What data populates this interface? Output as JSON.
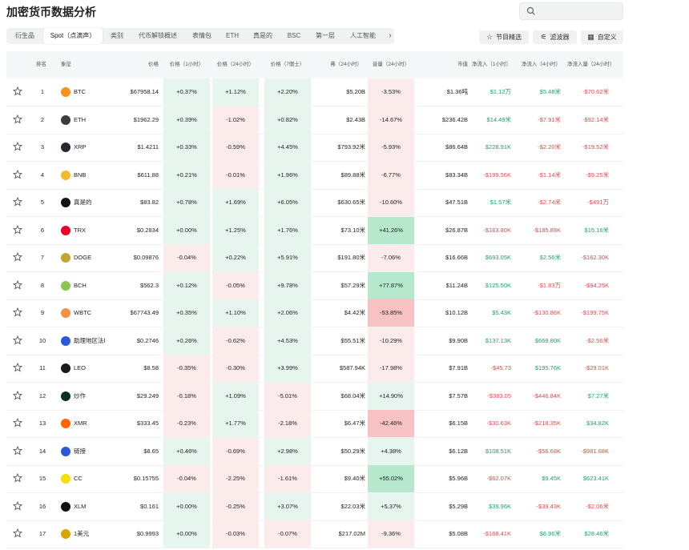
{
  "page": {
    "title": "加密货币数据分析"
  },
  "search": {
    "placeholder": ""
  },
  "tabs": [
    {
      "label": "衍生品"
    },
    {
      "label": "Spot（点滴声）"
    },
    {
      "label": "类别"
    },
    {
      "label": "代币解锁概述"
    },
    {
      "label": "表情包"
    },
    {
      "label": "ETH"
    },
    {
      "label": "真是的"
    },
    {
      "label": "BSC"
    },
    {
      "label": "第一层"
    },
    {
      "label": "人工智能"
    }
  ],
  "tab_more_icon": "chevron-right-icon",
  "toolbar": {
    "featured_label": "节目精选",
    "filter_label": "滤波器",
    "custom_label": "自定义"
  },
  "headers": {
    "rank": "排名",
    "symbol": "象征",
    "price": "价格",
    "chg_1h": "价格（1小时）",
    "chg_24h": "价格（24小时）",
    "chg_7d": "价格（7個士）",
    "vol_24h": "弗（24小时）",
    "vol_chg_24h": "音量（24小时）",
    "mcap": "市值",
    "inflow_1h": "净流入（1小时）",
    "inflow_4h": "净流入（4小时）",
    "inflow_24h": "净流入量（24小时）"
  },
  "colors": {
    "positive": "#1aa568",
    "negative": "#e04a4a",
    "positive_bg": "#e6f6ee",
    "negative_bg": "#fcebeb",
    "strong_positive_bg": "#b6e8cd",
    "strong_negative_bg": "#f8c2c2"
  },
  "rows": [
    {
      "rank": "1",
      "name": "BTC",
      "icon": "btc-icon",
      "icon_color": "#f7931a",
      "price": "$67958.14",
      "c1h": "+0.37%",
      "c24h": "+1.12%",
      "c7d": "+2.20%",
      "vol": "$5.20B",
      "volc": "-3.53%",
      "mcap": "$1.36吨",
      "in1h": "$1.12万",
      "in4h": "$5.48米",
      "in24h": "-$70.62米"
    },
    {
      "rank": "2",
      "name": "ETH",
      "icon": "eth-icon",
      "icon_color": "#3c3c3d",
      "price": "$1962.29",
      "c1h": "+0.39%",
      "c24h": "-1.02%",
      "c7d": "+0.82%",
      "vol": "$2.43B",
      "volc": "-14.67%",
      "mcap": "$236.42B",
      "in1h": "$14.49米",
      "in4h": "-$7.91米",
      "in24h": "-$92.14米"
    },
    {
      "rank": "3",
      "name": "XRP",
      "icon": "xrp-icon",
      "icon_color": "#23292f",
      "price": "$1.4211",
      "c1h": "+0.33%",
      "c24h": "-0.59%",
      "c7d": "+4.45%",
      "vol": "$793.92米",
      "volc": "-5.93%",
      "mcap": "$86.64B",
      "in1h": "$228.91K",
      "in4h": "-$2.20米",
      "in24h": "-$19.52米"
    },
    {
      "rank": "4",
      "name": "BNB",
      "icon": "bnb-icon",
      "icon_color": "#f3ba2f",
      "price": "$611.88",
      "c1h": "+0.21%",
      "c24h": "-0.01%",
      "c7d": "+1.96%",
      "vol": "$89.88米",
      "volc": "-6.77%",
      "mcap": "$83.34B",
      "in1h": "-$199.56K",
      "in4h": "-$1.14米",
      "in24h": "-$9.25米"
    },
    {
      "rank": "5",
      "name": "真是的",
      "icon": "sol-icon",
      "icon_color": "#111111",
      "price": "$83.82",
      "c1h": "+0.78%",
      "c24h": "+1.69%",
      "c7d": "+6.05%",
      "vol": "$630.65米",
      "volc": "-10.60%",
      "mcap": "$47.51B",
      "in1h": "$1.57米",
      "in4h": "-$2.74米",
      "in24h": "-$491万"
    },
    {
      "rank": "6",
      "name": "TRX",
      "icon": "trx-icon",
      "icon_color": "#eb0029",
      "price": "$0.2834",
      "c1h": "+0.00%",
      "c24h": "+1.25%",
      "c7d": "+1.76%",
      "vol": "$73.10米",
      "volc": "+41.26%",
      "mcap": "$26.87B",
      "in1h": "-$163.80K",
      "in4h": "-$185.89K",
      "in24h": "$15.16米"
    },
    {
      "rank": "7",
      "name": "DOGE",
      "icon": "doge-icon",
      "icon_color": "#c2a633",
      "price": "$0.09876",
      "c1h": "-0.04%",
      "c24h": "+0.22%",
      "c7d": "+5.91%",
      "vol": "$191.80米",
      "volc": "-7.06%",
      "mcap": "$16.66B",
      "in1h": "$693.05K",
      "in4h": "$2.56米",
      "in24h": "-$162.30K"
    },
    {
      "rank": "8",
      "name": "BCH",
      "icon": "bch-icon",
      "icon_color": "#8dc351",
      "price": "$562.3",
      "c1h": "+0.12%",
      "c24h": "-0.05%",
      "c7d": "+9.78%",
      "vol": "$57.29米",
      "volc": "+77.87%",
      "mcap": "$11.24B",
      "in1h": "$125.50K",
      "in4h": "-$1.83万",
      "in24h": "-$94.25K"
    },
    {
      "rank": "9",
      "name": "WBTC",
      "icon": "wbtc-icon",
      "icon_color": "#f09242",
      "price": "$67743.49",
      "c1h": "+0.35%",
      "c24h": "+1.10%",
      "c7d": "+2.06%",
      "vol": "$4.42米",
      "volc": "-53.85%",
      "mcap": "$10.12B",
      "in1h": "$5.43K",
      "in4h": "-$130.86K",
      "in24h": "-$199.75K"
    },
    {
      "rank": "10",
      "name": "助理地区法l",
      "icon": "link-icon",
      "icon_color": "#2a5ada",
      "price": "$0.2746",
      "c1h": "+0.26%",
      "c24h": "-0.62%",
      "c7d": "+4.53%",
      "vol": "$55.51米",
      "volc": "-10.29%",
      "mcap": "$9.90B",
      "in1h": "$137.13K",
      "in4h": "$669.80K",
      "in24h": "-$2.56米"
    },
    {
      "rank": "11",
      "name": "LEO",
      "icon": "leo-icon",
      "icon_color": "#1a1a1a",
      "price": "$8.58",
      "c1h": "-0.35%",
      "c24h": "-0.30%",
      "c7d": "+3.99%",
      "vol": "$587.94K",
      "volc": "-17.98%",
      "mcap": "$7.91B",
      "in1h": "-$45.73",
      "in4h": "$195.76K",
      "in24h": "-$29.01K"
    },
    {
      "rank": "12",
      "name": "炒作",
      "icon": "hype-icon",
      "icon_color": "#0b2e26",
      "price": "$29.249",
      "c1h": "-0.18%",
      "c24h": "+1.09%",
      "c7d": "-5.01%",
      "vol": "$68.04米",
      "volc": "+14.90%",
      "mcap": "$7.57B",
      "in1h": "-$383.05",
      "in4h": "-$446.84K",
      "in24h": "$7.27米"
    },
    {
      "rank": "13",
      "name": "XMR",
      "icon": "xmr-icon",
      "icon_color": "#ff6600",
      "price": "$333.45",
      "c1h": "-0.23%",
      "c24h": "+1.77%",
      "c7d": "-2.18%",
      "vol": "$6.47米",
      "volc": "-42.46%",
      "mcap": "$6.15B",
      "in1h": "-$30.63K",
      "in4h": "-$218.35K",
      "in24h": "$34.82K"
    },
    {
      "rank": "14",
      "name": "链接",
      "icon": "chainlink-icon",
      "icon_color": "#2a5ada",
      "price": "$8.65",
      "c1h": "+0.46%",
      "c24h": "-0.69%",
      "c7d": "+2.98%",
      "vol": "$50.29米",
      "volc": "+4.38%",
      "mcap": "$6.12B",
      "in1h": "$108.51K",
      "in4h": "-$56.68K",
      "in24h": "-$981.68K"
    },
    {
      "rank": "15",
      "name": "CC",
      "icon": "cc-icon",
      "icon_color": "#f5e000",
      "price": "$0.15755",
      "c1h": "-0.04%",
      "c24h": "-2.25%",
      "c7d": "-1.61%",
      "vol": "$9.40米",
      "volc": "+55.02%",
      "mcap": "$5.96B",
      "in1h": "-$62.07K",
      "in4h": "$9.45K",
      "in24h": "$623.41K"
    },
    {
      "rank": "16",
      "name": "XLM",
      "icon": "xlm-icon",
      "icon_color": "#111111",
      "price": "$0.161",
      "c1h": "+0.00%",
      "c24h": "-0.25%",
      "c7d": "+3.07%",
      "vol": "$22.03米",
      "volc": "+5.37%",
      "mcap": "$5.29B",
      "in1h": "$39.96K",
      "in4h": "-$39.43K",
      "in24h": "-$2.06米"
    },
    {
      "rank": "17",
      "name": "1美元",
      "icon": "usd1-icon",
      "icon_color": "#d9a400",
      "price": "$0.9993",
      "c1h": "+0.00%",
      "c24h": "-0.03%",
      "c7d": "-0.07%",
      "vol": "$217.02M",
      "volc": "-9.36%",
      "mcap": "$5.08B",
      "in1h": "-$168.41K",
      "in4h": "$6.96米",
      "in24h": "$28.46米"
    }
  ]
}
